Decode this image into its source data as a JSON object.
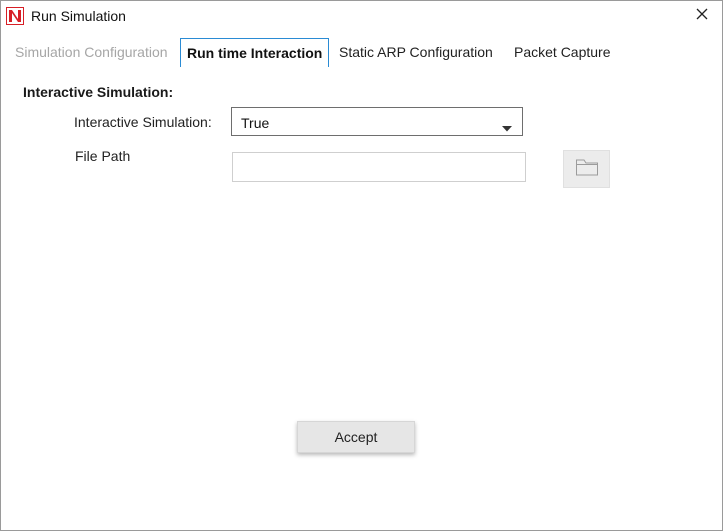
{
  "window": {
    "title": "Run Simulation",
    "accent_color": "#2a8bd4",
    "logo_color": "#d71f26"
  },
  "tabs": [
    {
      "label": "Simulation Configuration",
      "state": "disabled"
    },
    {
      "label": "Run time Interaction",
      "state": "active"
    },
    {
      "label": "Static ARP Configuration",
      "state": "normal"
    },
    {
      "label": "Packet Capture",
      "state": "normal"
    }
  ],
  "form": {
    "section_title": "Interactive Simulation:",
    "interactive_label": "Interactive Simulation:",
    "interactive_value": "True",
    "file_path_label": "File Path",
    "file_path_value": ""
  },
  "footer": {
    "accept_label": "Accept"
  }
}
